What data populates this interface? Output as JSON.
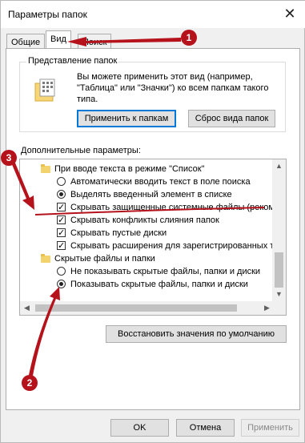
{
  "window": {
    "title": "Параметры папок",
    "close_glyph": "✕"
  },
  "tabs": [
    {
      "label": "Общие"
    },
    {
      "label": "Вид"
    },
    {
      "label": "Поиск"
    }
  ],
  "folder_views": {
    "title": "Представление папок",
    "description": "Вы можете применить этот вид (например, \"Таблица\" или \"Значки\") ко всем папкам такого типа.",
    "apply_label": "Применить к папкам",
    "reset_label": "Сброс вида папок",
    "icon": "folder-view-icon"
  },
  "advanced": {
    "title": "Дополнительные параметры:",
    "items": [
      {
        "type": "folder",
        "label": "При вводе текста в режиме \"Список\""
      },
      {
        "type": "radio",
        "checked": false,
        "label": "Автоматически вводить текст в поле поиска"
      },
      {
        "type": "radio",
        "checked": true,
        "label": "Выделять введенный элемент в списке"
      },
      {
        "type": "checkbox",
        "checked": true,
        "label": "Скрывать защищенные системные файлы (рекомен"
      },
      {
        "type": "checkbox",
        "checked": true,
        "label": "Скрывать конфликты слияния папок"
      },
      {
        "type": "checkbox",
        "checked": true,
        "label": "Скрывать пустые диски"
      },
      {
        "type": "checkbox",
        "checked": true,
        "label": "Скрывать расширения для зарегистрированных типо"
      },
      {
        "type": "folder",
        "label": "Скрытые файлы и папки"
      },
      {
        "type": "radio",
        "checked": false,
        "label": "Не показывать скрытые файлы, папки и диски"
      },
      {
        "type": "radio",
        "checked": true,
        "label": "Показывать скрытые файлы, папки и диски"
      }
    ],
    "scroll_up": "▲",
    "scroll_down": "▼",
    "scroll_left": "◀",
    "scroll_right": "▶"
  },
  "restore_label": "Восстановить значения по умолчанию",
  "footer": {
    "ok": "OK",
    "cancel": "Отмена",
    "apply": "Применить"
  },
  "annotations": {
    "color": "#b5121b",
    "badges": [
      "1",
      "2",
      "3"
    ]
  }
}
